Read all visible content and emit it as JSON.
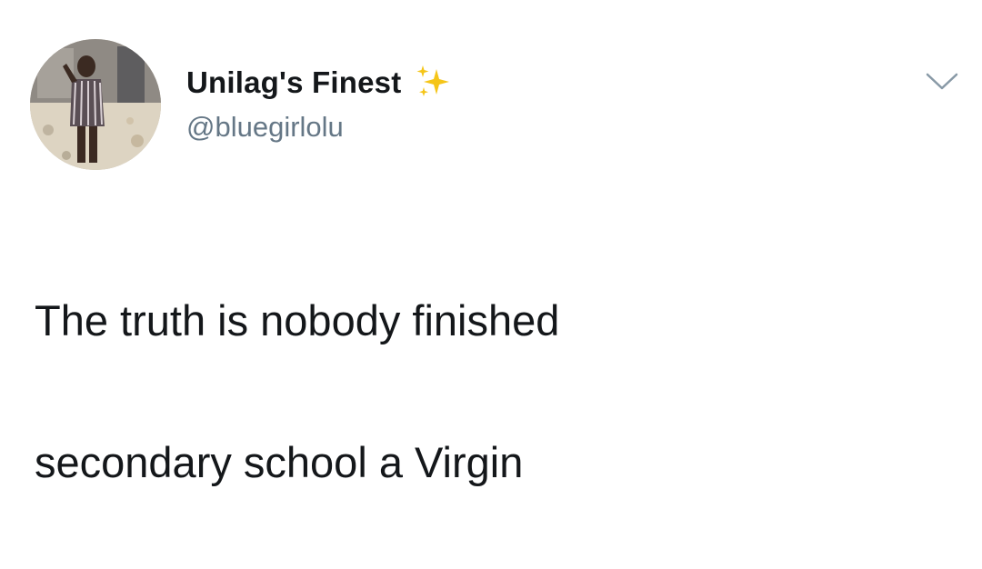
{
  "tweet": {
    "author": {
      "display_name": "Unilag's Finest",
      "handle": "@bluegirlolu",
      "name_emoji": "sparkles-icon",
      "avatar": "profile-photo"
    },
    "menu_icon": "chevron-down-icon",
    "text_lines": [
      "The truth is nobody finished",
      "secondary school a Virgin"
    ]
  },
  "colors": {
    "text": "#14171a",
    "secondary_text": "#657786",
    "sparkle": "#f5c518",
    "chevron": "#8899a6"
  }
}
